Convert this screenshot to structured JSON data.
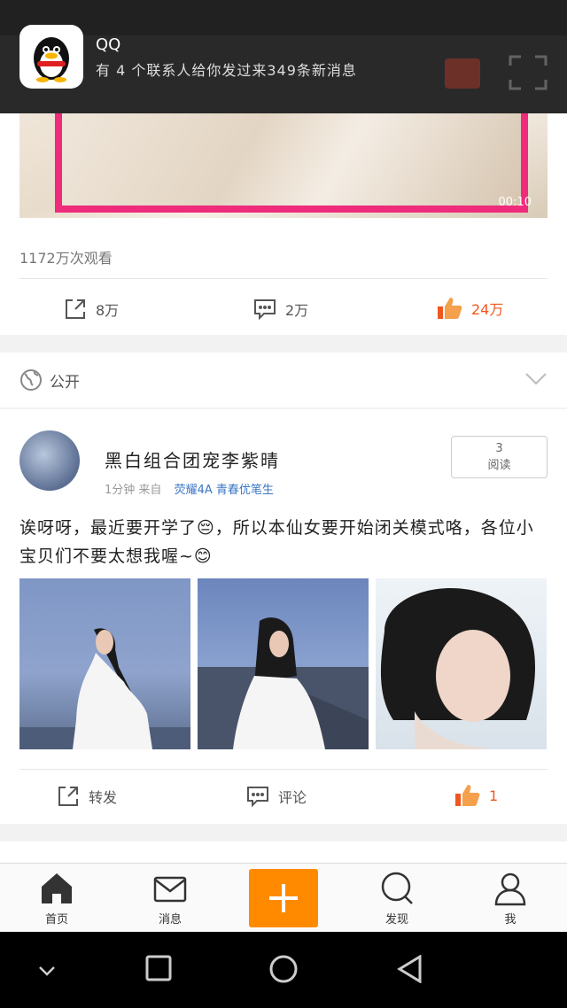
{
  "notification": {
    "app": "QQ",
    "message": "有 4 个联系人给你发过来349条新消息",
    "icon": "qq-penguin-icon"
  },
  "card_video": {
    "duration": "00:10",
    "views": "1172万次观看",
    "actions": {
      "share_count": "8万",
      "comment_count": "2万",
      "like_count": "24万"
    }
  },
  "visibility": {
    "label": "公开"
  },
  "post": {
    "author": "黑白组合团宠李紫晴",
    "time": "1分钟",
    "source_prefix": "来自",
    "source": "荧耀4A 青春优笔生",
    "read_count": "3",
    "read_label": "阅读",
    "text": "诶呀呀，最近要开学了😔，所以本仙女要开始闭关模式咯，各位小宝贝们不要太想我喔~😊",
    "actions": {
      "repost": "转发",
      "comment": "评论",
      "like_count": "1"
    }
  },
  "tabs": [
    {
      "label": "首页",
      "icon": "home-icon"
    },
    {
      "label": "消息",
      "icon": "mail-icon"
    },
    {
      "label": "发现",
      "icon": "search-icon"
    },
    {
      "label": "我",
      "icon": "person-icon"
    }
  ],
  "colors": {
    "accent": "#ff8a00",
    "like": "#f0571e",
    "link": "#3a76c4",
    "frame": "#ef2b7b"
  }
}
